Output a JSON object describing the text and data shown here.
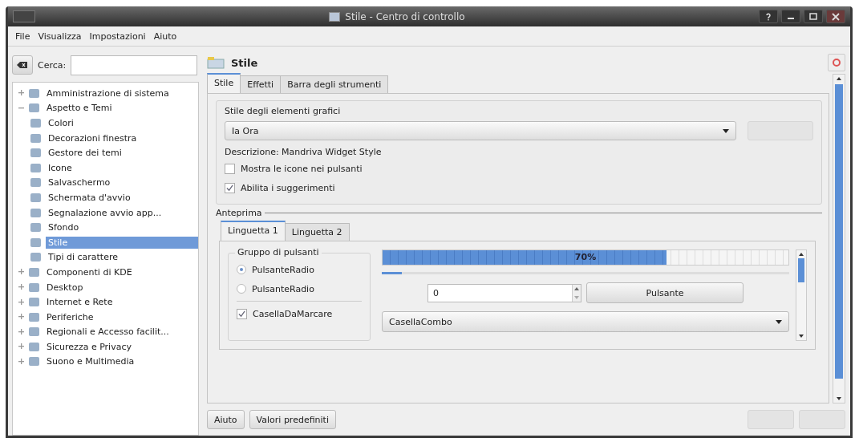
{
  "window": {
    "title": "Stile - Centro di controllo"
  },
  "menu": [
    "File",
    "Visualizza",
    "Impostazioni",
    "Aiuto"
  ],
  "search": {
    "label": "Cerca:"
  },
  "tree": [
    {
      "label": "Amministrazione di sistema",
      "expanded": false,
      "selected": false
    },
    {
      "label": "Aspetto e Temi",
      "expanded": true,
      "selected": false,
      "children": [
        {
          "label": "Colori",
          "selected": false
        },
        {
          "label": "Decorazioni finestra",
          "selected": false
        },
        {
          "label": "Gestore dei temi",
          "selected": false
        },
        {
          "label": "Icone",
          "selected": false
        },
        {
          "label": "Salvaschermo",
          "selected": false
        },
        {
          "label": "Schermata d'avvio",
          "selected": false
        },
        {
          "label": "Segnalazione avvio app...",
          "selected": false
        },
        {
          "label": "Sfondo",
          "selected": false
        },
        {
          "label": "Stile",
          "selected": true
        },
        {
          "label": "Tipi di carattere",
          "selected": false
        }
      ]
    },
    {
      "label": "Componenti di KDE",
      "expanded": false,
      "selected": false
    },
    {
      "label": "Desktop",
      "expanded": false,
      "selected": false
    },
    {
      "label": "Internet e Rete",
      "expanded": false,
      "selected": false
    },
    {
      "label": "Periferiche",
      "expanded": false,
      "selected": false
    },
    {
      "label": "Regionali e Accesso facilit...",
      "expanded": false,
      "selected": false
    },
    {
      "label": "Sicurezza e Privacy",
      "expanded": false,
      "selected": false
    },
    {
      "label": "Suono e Multimedia",
      "expanded": false,
      "selected": false
    }
  ],
  "header": {
    "title": "Stile"
  },
  "tabs": [
    {
      "label": "Stile",
      "selected": true
    },
    {
      "label": "Effetti",
      "selected": false
    },
    {
      "label": "Barra degli strumenti",
      "selected": false
    }
  ],
  "widget_style": {
    "group_title": "Stile degli elementi grafici",
    "value": "Ia Ora",
    "configure": {
      "disabled": true
    },
    "description": "Descrizione: Mandriva Widget Style",
    "options": [
      {
        "label": "Mostra le icone nei pulsanti",
        "checked": false
      },
      {
        "label": "Abilita i suggerimenti",
        "checked": true
      }
    ]
  },
  "preview": {
    "title": "Anteprima",
    "tabs": [
      {
        "label": "Linguetta 1",
        "selected": true
      },
      {
        "label": "Linguetta 2",
        "selected": false
      }
    ],
    "group_title": "Gruppo di pulsanti",
    "radios": [
      {
        "label": "PulsanteRadio",
        "selected": true
      },
      {
        "label": "PulsanteRadio",
        "selected": false
      }
    ],
    "checkbox": {
      "label": "CasellaDaMarcare",
      "checked": true
    },
    "progress": {
      "level": 0.7,
      "reading": "70%"
    },
    "slider": {
      "level": 0.05
    },
    "spin": {
      "value": "0"
    },
    "button": "Pulsante",
    "combo": {
      "value": "CasellaCombo"
    }
  },
  "footer": {
    "buttons": [
      "Aiuto",
      "Valori predefiniti"
    ],
    "right_buttons": [
      {
        "disabled": true
      },
      {
        "disabled": true
      }
    ]
  }
}
